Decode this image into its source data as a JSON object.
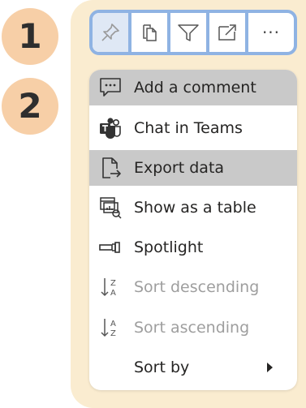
{
  "steps": {
    "first": "1",
    "second": "2"
  },
  "toolbar": {
    "buttons": [
      {
        "icon": "pin-icon"
      },
      {
        "icon": "copy-icon"
      },
      {
        "icon": "filter-icon"
      },
      {
        "icon": "focus-mode-icon"
      },
      {
        "icon": "more-options-icon",
        "label": "···"
      }
    ]
  },
  "menu": {
    "items": [
      {
        "label": "Add a comment",
        "icon": "comment-icon",
        "highlighted": true,
        "enabled": true
      },
      {
        "label": "Chat in Teams",
        "icon": "teams-icon",
        "highlighted": false,
        "enabled": true
      },
      {
        "label": "Export data",
        "icon": "export-icon",
        "highlighted": true,
        "enabled": true
      },
      {
        "label": "Show as a table",
        "icon": "table-view-icon",
        "highlighted": false,
        "enabled": true
      },
      {
        "label": "Spotlight",
        "icon": "spotlight-icon",
        "highlighted": false,
        "enabled": true
      },
      {
        "label": "Sort descending",
        "icon": "sort-descending-icon",
        "highlighted": false,
        "enabled": false
      },
      {
        "label": "Sort ascending",
        "icon": "sort-ascending-icon",
        "highlighted": false,
        "enabled": false
      },
      {
        "label": "Sort by",
        "icon": "",
        "highlighted": false,
        "enabled": true
      }
    ]
  },
  "colors": {
    "panel": "#faecd0",
    "badge": "#f7cfa7",
    "toolbar_border": "#8fb3e3",
    "highlight": "#c9c9c9",
    "text": "#252423",
    "disabled_text": "#9e9e9e"
  }
}
